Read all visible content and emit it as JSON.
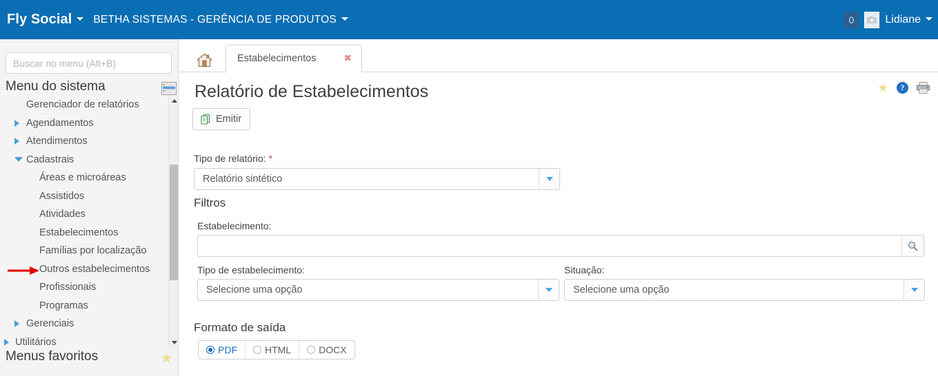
{
  "header": {
    "brand": "Fly Social",
    "organization": "BETHA SISTEMAS - GERÊNCIA DE PRODUTOS",
    "notification_count": "0",
    "username": "Lidiane",
    "brand_bg": "#0a6eb4"
  },
  "sidebar": {
    "search_placeholder": "Buscar no menu (Alt+B)",
    "search_value": "",
    "system_menu_title": "Menu do sistema",
    "favorites_title": "Menus favoritos",
    "items": [
      {
        "label": "Gerenciador de relatórios",
        "level": 1,
        "toggle": "none"
      },
      {
        "label": "Agendamentos",
        "level": 1,
        "toggle": "collapsed"
      },
      {
        "label": "Atendimentos",
        "level": 1,
        "toggle": "collapsed"
      },
      {
        "label": "Cadastrais",
        "level": 1,
        "toggle": "expanded"
      },
      {
        "label": "Áreas e microáreas",
        "level": 2,
        "toggle": "none"
      },
      {
        "label": "Assistidos",
        "level": 2,
        "toggle": "none"
      },
      {
        "label": "Atividades",
        "level": 2,
        "toggle": "none"
      },
      {
        "label": "Estabelecimentos",
        "level": 2,
        "toggle": "none"
      },
      {
        "label": "Famílias por localização",
        "level": 2,
        "toggle": "none"
      },
      {
        "label": "Outros estabelecimentos",
        "level": 2,
        "toggle": "none"
      },
      {
        "label": "Profissionais",
        "level": 2,
        "toggle": "none"
      },
      {
        "label": "Programas",
        "level": 2,
        "toggle": "none"
      },
      {
        "label": "Gerenciais",
        "level": 1,
        "toggle": "collapsed"
      },
      {
        "label": "Utilitários",
        "level": 0,
        "toggle": "collapsed"
      }
    ],
    "annotation": {
      "type": "red-arrow",
      "points_at": "Estabelecimentos"
    }
  },
  "tabs": {
    "home_label": "",
    "active": {
      "label": "Estabelecimentos",
      "close": "✖"
    }
  },
  "page": {
    "title": "Relatório de Estabelecimentos",
    "emit_button": "Emitir"
  },
  "form": {
    "tipo_relatorio": {
      "label": "Tipo de relatório:",
      "required_mark": "*",
      "value": "Relatório sintético"
    },
    "filtros_heading": "Filtros",
    "estabelecimento": {
      "label": "Estabelecimento:",
      "value": "",
      "placeholder": ""
    },
    "tipo_estabelecimento": {
      "label": "Tipo de estabelecimento:",
      "value": "Selecione uma opção"
    },
    "situacao": {
      "label": "Situação:",
      "value": "Selecione uma opção"
    },
    "formato_saida": {
      "heading": "Formato de saída",
      "options": [
        {
          "label": "PDF",
          "selected": true
        },
        {
          "label": "HTML",
          "selected": false
        },
        {
          "label": "DOCX",
          "selected": false
        }
      ]
    }
  }
}
